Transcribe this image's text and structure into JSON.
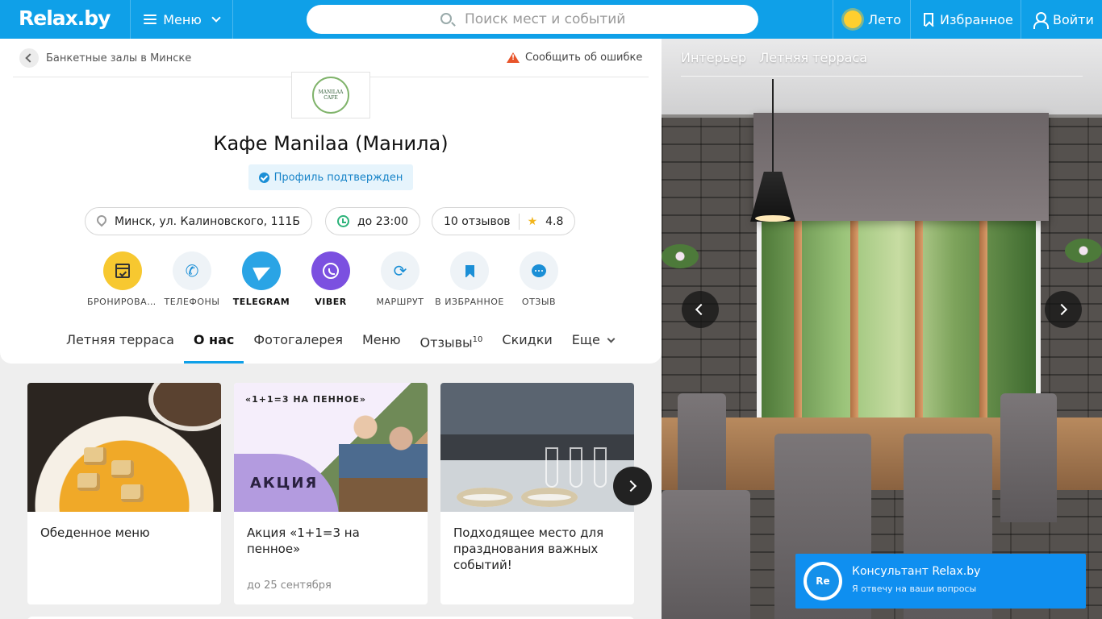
{
  "header": {
    "logo": "Relax.by",
    "menu_label": "Меню",
    "search_placeholder": "Поиск мест и событий",
    "season_label": "Лето",
    "favorites_label": "Избранное",
    "login_label": "Войти",
    "brand_color": "#0fa0e8"
  },
  "breadcrumb": {
    "label": "Банкетные залы в Минске"
  },
  "report_label": "Сообщить об ошибке",
  "venue": {
    "logo_text_1": "MANILAA",
    "logo_text_2": "CAFE",
    "title": "Кафе Manilaa (Манила)",
    "verified_label": "Профиль подтвержден",
    "address": "Минск, ул. Калиновского, 111Б",
    "hours": "до 23:00",
    "reviews": "10 отзывов",
    "rating": "4.8"
  },
  "actions": [
    {
      "label": "БРОНИРОВАНИЕ",
      "icon": "calendar-icon",
      "color": "#f7c830"
    },
    {
      "label": "ТЕЛЕФОНЫ",
      "icon": "phone-icon",
      "color": "#eef3f7"
    },
    {
      "label": "TELEGRAM",
      "icon": "telegram-icon",
      "color": "#2aa4e5"
    },
    {
      "label": "VIBER",
      "icon": "viber-icon",
      "color": "#7b50e0"
    },
    {
      "label": "МАРШРУТ",
      "icon": "route-icon",
      "color": "#eef3f7"
    },
    {
      "label": "В ИЗБРАННОЕ",
      "icon": "bookmark-icon",
      "color": "#eef3f7"
    },
    {
      "label": "ОТЗЫВ",
      "icon": "chat-icon",
      "color": "#eef3f7"
    }
  ],
  "tabs": {
    "summer": "Летняя терраса",
    "about": "О нас",
    "photos": "Фотогалерея",
    "menu": "Меню",
    "reviews": "Отзывы",
    "reviews_count": "10",
    "discounts": "Скидки",
    "more": "Еще"
  },
  "offers": [
    {
      "title": "Обеденное меню",
      "date": ""
    },
    {
      "title": "Акция «1+1=3 на пенное»",
      "date": "до 25 сентября",
      "promo_top": "«1+1=3 НА ПЕННОЕ»",
      "promo_label": "АКЦИЯ"
    },
    {
      "title": "Подходящее место для празднования важных событий!",
      "date": ""
    }
  ],
  "gallery": {
    "tabs": [
      "Интерьер",
      "Летняя терраса"
    ]
  },
  "consultant": {
    "avatar_text": "Re",
    "title": "Консультант Relax.by",
    "subtitle": "Я отвечу на ваши вопросы"
  }
}
